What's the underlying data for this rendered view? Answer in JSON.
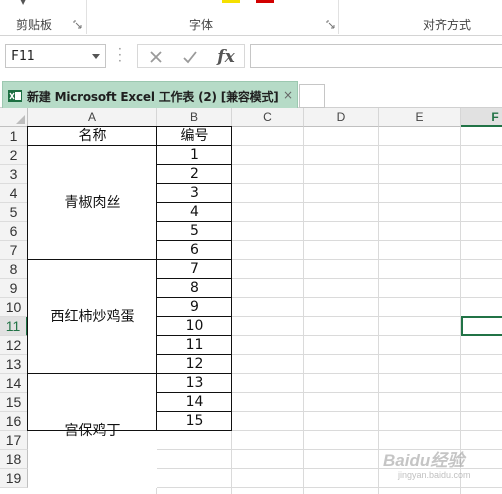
{
  "ribbon": {
    "groups": [
      {
        "label": "剪贴板"
      },
      {
        "label": "字体"
      },
      {
        "label": "对齐方式"
      }
    ],
    "colors": {
      "yellow": "#f5e000",
      "red": "#d20000"
    }
  },
  "formula_bar": {
    "name_box": "F11",
    "formula": ""
  },
  "document_tab": {
    "title": "新建 Microsoft Excel 工作表 (2)  [兼容模式]",
    "close": "×"
  },
  "sheet": {
    "columns": [
      "A",
      "B",
      "C",
      "D",
      "E",
      "F"
    ],
    "selected_column": "F",
    "rows": [
      "1",
      "2",
      "3",
      "4",
      "5",
      "6",
      "7",
      "8",
      "9",
      "10",
      "11",
      "12",
      "13",
      "14",
      "15",
      "16",
      "17",
      "18",
      "19"
    ],
    "selected_row": "11",
    "header_name": "名称",
    "header_number": "编号",
    "groups": [
      {
        "name": "青椒肉丝"
      },
      {
        "name": "西红柿炒鸡蛋"
      },
      {
        "name": "宫保鸡丁"
      }
    ],
    "numbers": [
      "1",
      "2",
      "3",
      "4",
      "5",
      "6",
      "7",
      "8",
      "9",
      "10",
      "11",
      "12",
      "13",
      "14",
      "15"
    ]
  },
  "watermark": {
    "text": "Baidu经验",
    "sub": "jingyan.baidu.com"
  },
  "accent_color": "#217346"
}
